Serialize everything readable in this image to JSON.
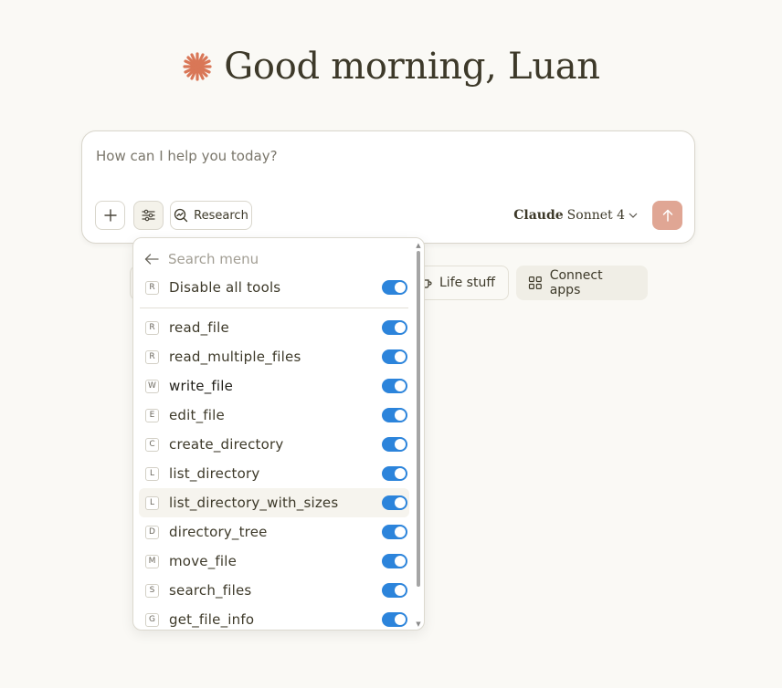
{
  "greeting": {
    "text": "Good morning, Luan",
    "spark_color": "#d97757"
  },
  "composer": {
    "placeholder": "How can I help you today?",
    "research_label": "Research",
    "model_brand": "Claude",
    "model_name": "Sonnet 4",
    "send_color": "#e0a694"
  },
  "chips": [
    {
      "label": "Life stuff",
      "icon": "mug-icon"
    },
    {
      "label": "Connect apps",
      "icon": "grid-icon"
    }
  ],
  "menu": {
    "search_placeholder": "Search menu",
    "disable_all": {
      "badge": "R",
      "label": "Disable all tools",
      "enabled": true
    },
    "tools": [
      {
        "badge": "R",
        "label": "read_file",
        "enabled": true
      },
      {
        "badge": "R",
        "label": "read_multiple_files",
        "enabled": true
      },
      {
        "badge": "W",
        "label": "write_file",
        "enabled": true
      },
      {
        "badge": "E",
        "label": "edit_file",
        "enabled": true
      },
      {
        "badge": "C",
        "label": "create_directory",
        "enabled": true
      },
      {
        "badge": "L",
        "label": "list_directory",
        "enabled": true
      },
      {
        "badge": "L",
        "label": "list_directory_with_sizes",
        "enabled": true
      },
      {
        "badge": "D",
        "label": "directory_tree",
        "enabled": true
      },
      {
        "badge": "M",
        "label": "move_file",
        "enabled": true
      },
      {
        "badge": "S",
        "label": "search_files",
        "enabled": true
      },
      {
        "badge": "G",
        "label": "get_file_info",
        "enabled": true
      }
    ],
    "toggle_color": "#2c84db"
  }
}
